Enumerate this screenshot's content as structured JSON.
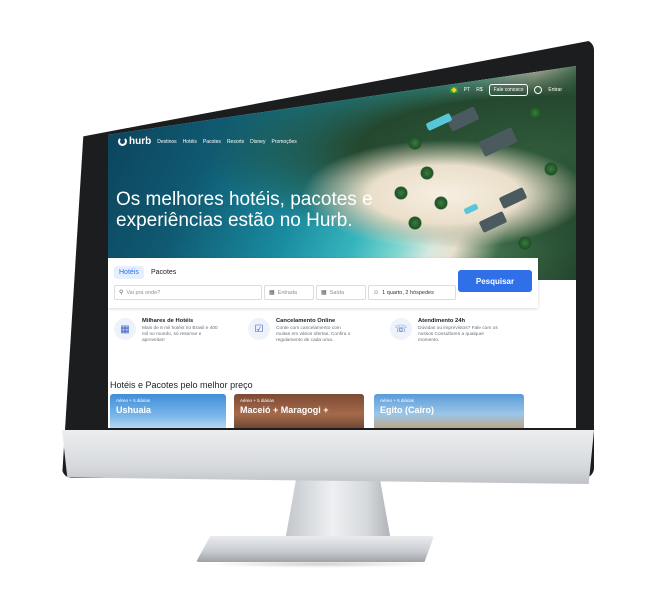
{
  "header": {
    "brand": "hurb",
    "nav": [
      "Destinos",
      "Hotéis",
      "Pacotes",
      "Resorts",
      "Disney",
      "Promoções"
    ],
    "top_right": {
      "lang": "PT",
      "currency": "R$",
      "contact_button": "Fale conosco",
      "login": "Entrar"
    }
  },
  "hero": {
    "title": "Os melhores hotéis, pacotes e experiências estão no Hurb."
  },
  "search": {
    "tabs": [
      "Hotéis",
      "Pacotes"
    ],
    "active_tab": "Hotéis",
    "destination_placeholder": "Vai pra onde?",
    "checkin_placeholder": "Entrada",
    "checkout_placeholder": "Saída",
    "guests_value": "1 quarto, 2 hóspedes",
    "submit_label": "Pesquisar"
  },
  "features": [
    {
      "icon": "building-icon",
      "title": "Milhares de Hotéis",
      "text": "Mais de 8 mil hotéis no Brasil e 400 mil no mundo, só reservar e aproveitar!"
    },
    {
      "icon": "calendar-icon",
      "title": "Cancelamento Online",
      "text": "Conte com cancelamento com muitas em vários ofertas. Confira o regulamento de cada uma."
    },
    {
      "icon": "headset-icon",
      "title": "Atendimento 24h",
      "text": "Dúvidas ou imprevistos? Fale com os nossos Consultores a qualquer momento."
    }
  ],
  "deals": {
    "section_title": "Hotéis e Pacotes pelo melhor preço",
    "cards": [
      {
        "subtitle": "Aéreo + 5 diárias",
        "title": "Ushuaia"
      },
      {
        "subtitle": "Aéreo + 5 diárias",
        "title": "Maceió + Maragogi +"
      },
      {
        "subtitle": "Aéreo + 5 diárias",
        "title": "Egito (Cairo)"
      }
    ]
  },
  "colors": {
    "accent": "#2f6fe8",
    "bezel": "#1c1d1f",
    "chin": "#d6d9dc"
  }
}
